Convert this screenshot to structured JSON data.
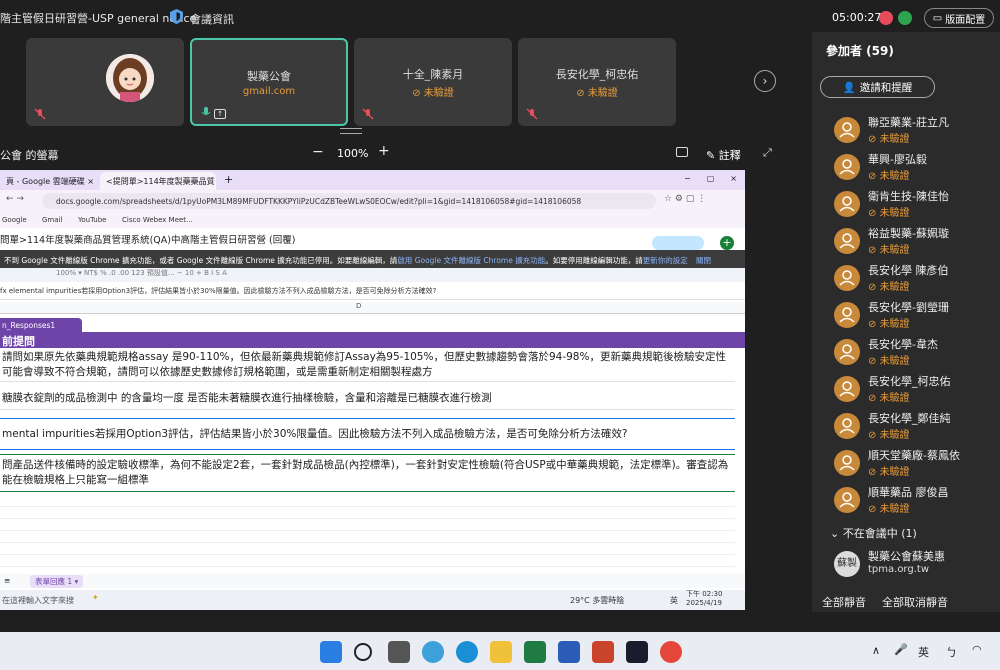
{
  "top_bar": {
    "meeting_title": "階主管假日研習營-USP general notice",
    "room_label": "會議資訊",
    "timer": "05:00:27",
    "layout_button": "版面配置"
  },
  "video_tiles": [
    {
      "name": "",
      "sub": ""
    },
    {
      "name": "製藥公會",
      "sub": "gmail.com"
    },
    {
      "name": "十全_陳素月",
      "sub": "未驗證"
    },
    {
      "name": "長安化學_柯忠佑",
      "sub": "未驗證"
    }
  ],
  "share_bar": {
    "label": "公會 的螢幕",
    "zoom_minus": "−",
    "zoom": "100%",
    "zoom_plus": "+",
    "notes": "註釋"
  },
  "browser": {
    "tabs": [
      "頁 - Google 雲端硬碟",
      "<提問單>114年度製藥藥品質"
    ],
    "url": "docs.google.com/spreadsheets/d/1pyUoPM3LM89MFUDFTKKKPYliPzUCdZBTeeWLwS0EOCw/edit?pli=1&gid=1418106058#gid=1418106058",
    "bookmarks": [
      "Google",
      "Gmail",
      "YouTube",
      "Cisco Webex Meet..."
    ],
    "doc_title": "問單>114年度製藥商品質管理系統(QA)中高階主管假日研習營 (回覆)",
    "notice_text_1": "不到 Google 文件離線版 Chrome 擴充功能，或者 Google 文件離線版 Chrome 擴充功能已停用。如要離線編輯，請",
    "notice_link": "啟用 Google 文件離線版 Chrome 擴充功能",
    "notice_text_2": "。如要停用離線編輯功能，請",
    "notice_link2": "更新你的設定",
    "notice_close": "關閉",
    "toolbar_text": "100% ▾   NT$   %   .0   .00   123   預設值...   −  10  +   B  I  S  A",
    "formula_text": "fx   elemental impurities若採用Option3評估，評估結果皆小於30%限量值。因此檢驗方法不列入成品檢驗方法，是否可免除分析方法確效?",
    "col_letter": "D",
    "sheet_tab": "n_Responses1",
    "header": "前提問",
    "rows": [
      "請問如果原先依藥典規範規格assay 是90-110%，但依最新藥典規範修訂Assay為95-105%，但歷史數據趨勢會落於94-98%，更新藥典規範後檢驗安定性可能會導致不符合規範，請問可以依據歷史數據修訂規格範圍，或是需重新制定相關製程處方",
      "糖膜衣錠劑的成品檢測中 的含量均一度 是否能未著糖膜衣進行抽樣檢驗，含量和溶離是已糖膜衣進行檢測",
      "mental impurities若採用Option3評估，評估結果皆小於30%限量值。因此檢驗方法不列入成品檢驗方法，是否可免除分析方法確效?",
      "問產品送件核備時的設定驗收標準，為何不能設定2套，一套針對成品檢品(內控標準)，一套針對安定性檢驗(符合USP或中華藥典規範，法定標準)。審查認為能在檢驗規格上只能寫一組標準"
    ],
    "bottom_tab": "表單回應 1",
    "search_placeholder": "在這裡輸入文字來搜",
    "weather": "29°C  多雲時陰",
    "lang": "英",
    "clock_time": "下午 02:30",
    "clock_date": "2025/4/19"
  },
  "participants_panel": {
    "title": "參加者 (59)",
    "invite_label": "邀請和提醒",
    "participants": [
      {
        "name": "聯亞藥業-莊立凡",
        "status": "未驗證"
      },
      {
        "name": "華興-廖弘毅",
        "status": "未驗證"
      },
      {
        "name": "衛肯生技-陳佳怡",
        "status": "未驗證"
      },
      {
        "name": "裕益製藥-蘇姵璇",
        "status": "未驗證"
      },
      {
        "name": "長安化學 陳彥伯",
        "status": "未驗證"
      },
      {
        "name": "長安化學-劉瑩珊",
        "status": "未驗證"
      },
      {
        "name": "長安化學-韋杰",
        "status": "未驗證"
      },
      {
        "name": "長安化學_柯忠佑",
        "status": "未驗證"
      },
      {
        "name": "長安化學_鄭佳純",
        "status": "未驗證"
      },
      {
        "name": "順天堂藥廠-蔡鳳依",
        "status": "未驗證"
      },
      {
        "name": "順華藥品 廖俊昌",
        "status": "未驗證"
      }
    ],
    "absent_label": "不在會議中 (1)",
    "absent_person": {
      "avatar": "蘇製",
      "name": "製藥公會蘇美惠",
      "sub": "tpma.org.tw"
    },
    "mute_all": "全部靜音",
    "unmute_all": "全部取消靜音"
  },
  "os_taskbar": {
    "lang": "英"
  },
  "colors": {
    "accent": "#4cc6a8",
    "unverified": "#e89b3a",
    "sheet_purple": "#6e44a8",
    "avatar_bg": "#c9893a"
  }
}
